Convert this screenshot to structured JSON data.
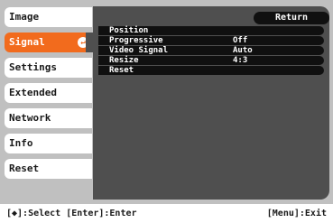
{
  "menu": {
    "items": [
      {
        "label": "Image"
      },
      {
        "label": "Signal"
      },
      {
        "label": "Settings"
      },
      {
        "label": "Extended"
      },
      {
        "label": "Network"
      },
      {
        "label": "Info"
      },
      {
        "label": "Reset"
      }
    ],
    "active_index": 1,
    "enter_glyph": "↵"
  },
  "panel": {
    "return_label": "Return",
    "rows": [
      {
        "label": "Position",
        "value": ""
      },
      {
        "label": "Progressive",
        "value": "Off"
      },
      {
        "label": "Video Signal",
        "value": "Auto"
      },
      {
        "label": "Resize",
        "value": "4:3"
      },
      {
        "label": "Reset",
        "value": ""
      }
    ]
  },
  "footer": {
    "select_hint": "[◆]:Select",
    "enter_hint": "[Enter]:Enter",
    "exit_hint": "[Menu]:Exit"
  },
  "colors": {
    "accent": "#f26b1d",
    "panel": "#4f4f4f",
    "screen": "#c0c0c0"
  }
}
